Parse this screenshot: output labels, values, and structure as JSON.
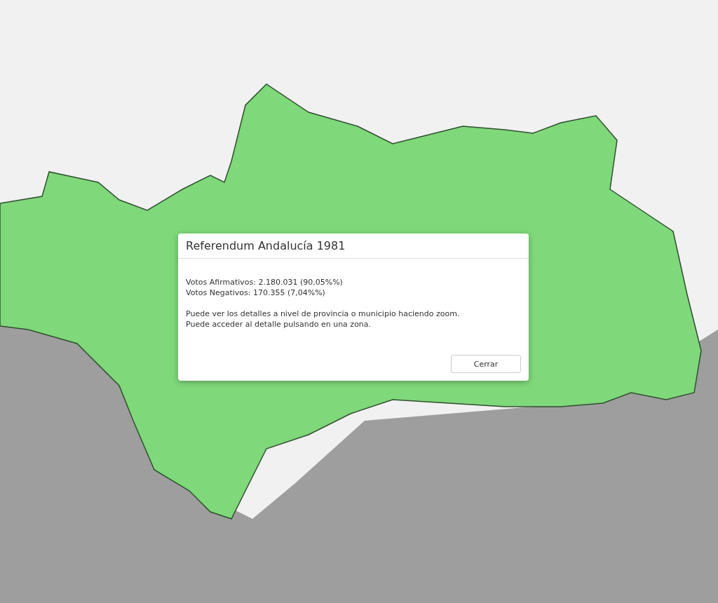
{
  "dialog": {
    "title": "Referendum Andalucía 1981",
    "results": [
      "Votos Afirmativos: 2.180.031 (90,05%%)",
      "Votos Negativos: 170.355 (7,04%%)"
    ],
    "notes": [
      "Puede ver los detalles a nivel de provincia o municipio haciendo zoom.",
      "Puede acceder al detalle pulsando en una zona."
    ],
    "close_button": "Cerrar"
  }
}
